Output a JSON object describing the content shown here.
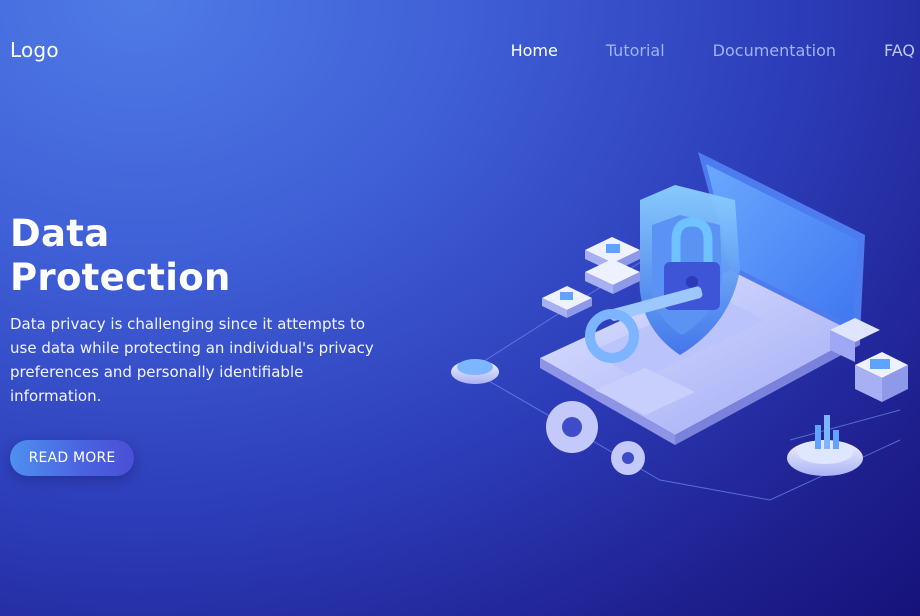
{
  "header": {
    "logo": "Logo",
    "nav": [
      {
        "label": "Home",
        "active": true
      },
      {
        "label": "Tutorial",
        "active": false
      },
      {
        "label": "Documentation",
        "active": false
      },
      {
        "label": "FAQ",
        "active": false
      }
    ]
  },
  "hero": {
    "title_line1": "Data",
    "title_line2": "Protection",
    "description": "Data privacy is challenging since it attempts to use data while protecting an individual's privacy preferences and personally identifiable information.",
    "button_label": "READ MORE"
  },
  "illustration": {
    "subject": "laptop-with-shield-lock-and-key",
    "colors": {
      "accent": "#5fa8ff",
      "light": "#c9d6ff",
      "background_dark": "#16127a"
    }
  }
}
